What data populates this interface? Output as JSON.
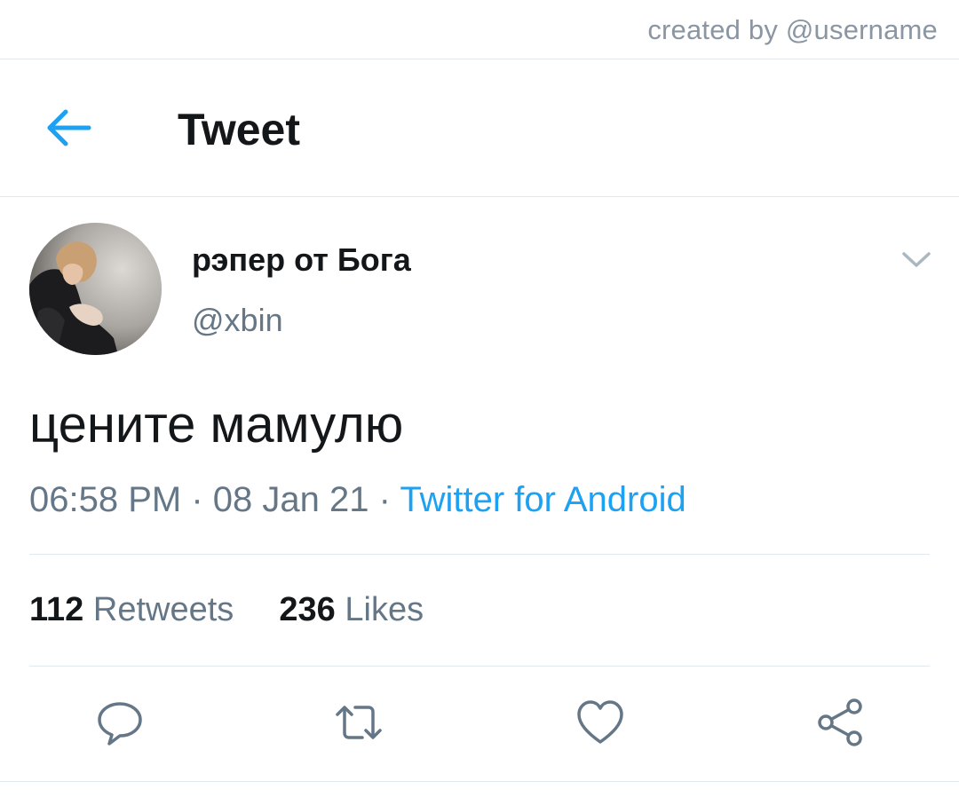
{
  "watermark": "created by @username",
  "header": {
    "title": "Tweet",
    "back_icon": "arrow-left-icon",
    "accent_color": "#1da1f2"
  },
  "tweet": {
    "display_name": "рэпер от Бога",
    "handle": "@xbin",
    "text": "цените мамулю",
    "time": "06:58 PM",
    "separator": "·",
    "date": "08 Jan 21",
    "source": "Twitter for Android",
    "menu_icon": "chevron-down-icon"
  },
  "stats": {
    "retweets_count": "112",
    "retweets_label": "Retweets",
    "likes_count": "236",
    "likes_label": "Likes"
  },
  "actions": {
    "reply_icon": "reply-icon",
    "retweet_icon": "retweet-icon",
    "like_icon": "heart-icon",
    "share_icon": "share-icon"
  },
  "colors": {
    "text_primary": "#14171a",
    "text_secondary": "#657786",
    "link": "#1da1f2",
    "divider": "#e1e8ed"
  }
}
